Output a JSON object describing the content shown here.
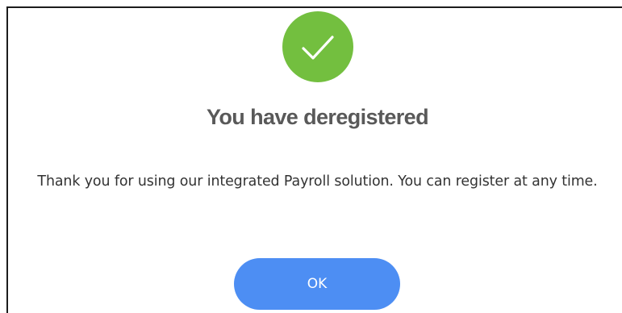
{
  "dialog": {
    "icon": "checkmark-success-icon",
    "title": "You have deregistered",
    "message": "Thank you for using our integrated Payroll solution. You can register at any time.",
    "ok_button_label": "OK"
  },
  "colors": {
    "success_green": "#73bf3f",
    "button_blue": "#4d8ef3",
    "title_gray": "#595959",
    "text_dark": "#333333",
    "border": "#1c1c1c"
  }
}
